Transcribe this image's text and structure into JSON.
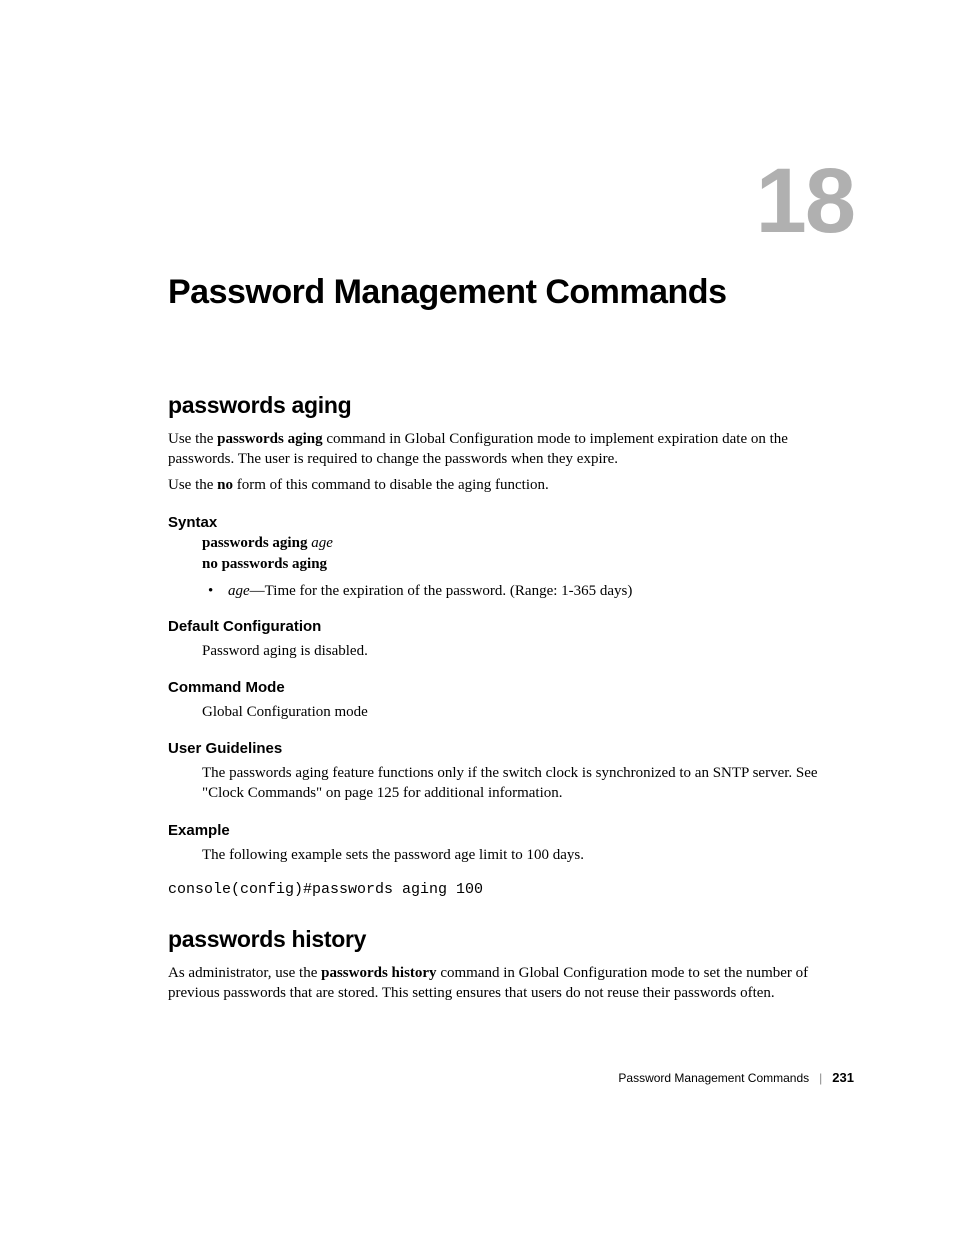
{
  "chapter": {
    "number": "18",
    "title": "Password Management Commands"
  },
  "sections": {
    "s1": {
      "title": "passwords aging",
      "intro1_pre": "Use the ",
      "intro1_bold": "passwords aging",
      "intro1_post": " command in Global Configuration mode to implement expiration date on the passwords. The user is required to change the passwords when they expire.",
      "intro2_pre": "Use the ",
      "intro2_bold": "no",
      "intro2_post": " form of this command to disable the aging function.",
      "syntax_heading": "Syntax",
      "syntax_line1_bold": "passwords aging ",
      "syntax_line1_italic": "age",
      "syntax_line2": "no passwords aging",
      "bullet_italic": "age",
      "bullet_rest": "—Time for the expiration of the password. (Range: 1-365 days)",
      "default_heading": "Default Configuration",
      "default_text": "Password aging is disabled.",
      "mode_heading": "Command Mode",
      "mode_text": "Global Configuration mode",
      "guidelines_heading": "User Guidelines",
      "guidelines_text": "The passwords aging feature functions only if the switch clock is synchronized to an SNTP server. See \"Clock Commands\" on page 125 for additional information.",
      "example_heading": "Example",
      "example_text": "The following example sets the password age limit to 100 days.",
      "example_code": "console(config)#passwords aging 100"
    },
    "s2": {
      "title": "passwords history",
      "intro_pre": "As administrator, use the ",
      "intro_bold": "passwords history",
      "intro_post": " command in Global Configuration mode to set the number of previous passwords that are stored. This setting ensures that users do not reuse their passwords often."
    }
  },
  "footer": {
    "label": "Password Management Commands",
    "page": "231"
  }
}
